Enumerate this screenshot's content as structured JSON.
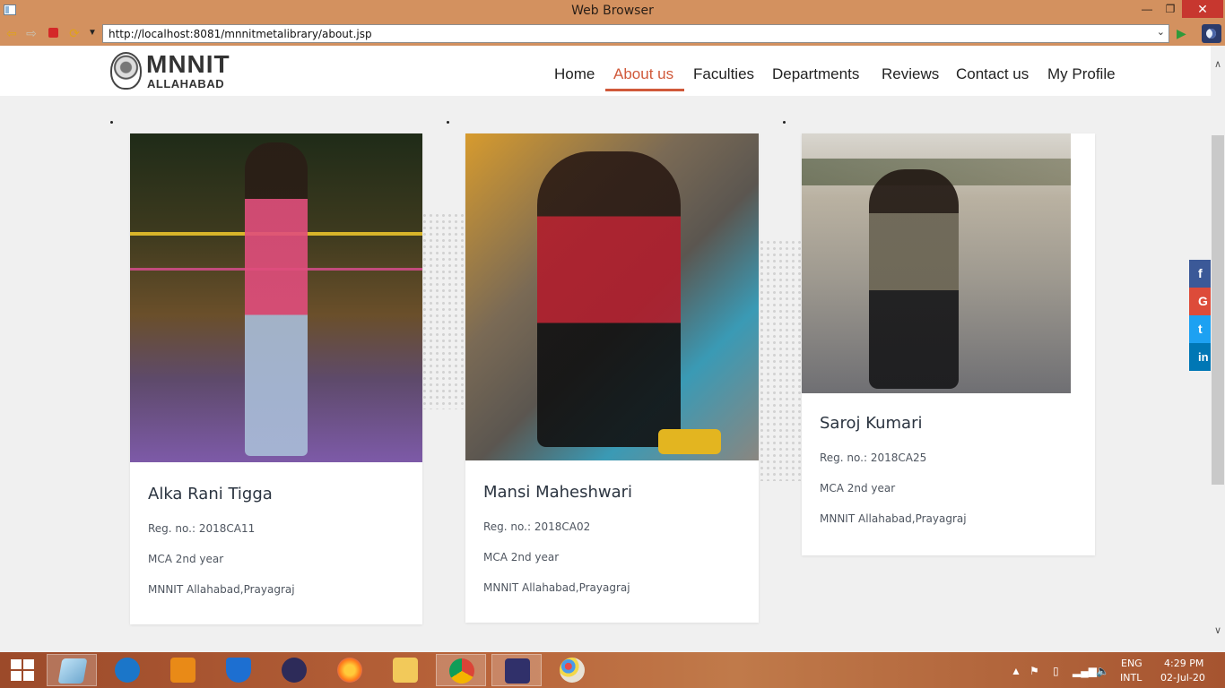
{
  "window": {
    "title": "Web Browser",
    "minimize": "—",
    "maximize": "❐",
    "close": "✕"
  },
  "addressbar": {
    "url": "http://localhost:8081/mnnitmetalibrary/about.jsp",
    "dropdown": "⌄"
  },
  "site": {
    "logo_top": "MNNIT",
    "logo_bottom": "ALLAHABAD",
    "nav": [
      "Home",
      "About us",
      "Faculties",
      "Departments",
      "Reviews",
      "Contact us",
      "My Profile"
    ],
    "active_nav": "About us",
    "accent_color": "#d0593a"
  },
  "members": [
    {
      "name": "Alka Rani Tigga",
      "reg": "Reg. no.: 2018CA11",
      "course": "MCA 2nd year",
      "institute": "MNNIT Allahabad,Prayagraj"
    },
    {
      "name": "Mansi Maheshwari",
      "reg": "Reg. no.: 2018CA02",
      "course": "MCA 2nd year",
      "institute": "MNNIT Allahabad,Prayagraj"
    },
    {
      "name": "Saroj Kumari",
      "reg": "Reg. no.: 2018CA25",
      "course": "MCA 2nd year",
      "institute": "MNNIT Allahabad,Prayagraj"
    }
  ],
  "share": [
    {
      "label": "f",
      "color": "#3b5998"
    },
    {
      "label": "G",
      "color": "#dd4b39"
    },
    {
      "label": "t",
      "color": "#1da1f2"
    },
    {
      "label": "in",
      "color": "#0077b5"
    }
  ],
  "taskbar": {
    "lang": "ENG",
    "layout": "INTL",
    "time": "4:29 PM",
    "date": "02-Jul-20"
  }
}
